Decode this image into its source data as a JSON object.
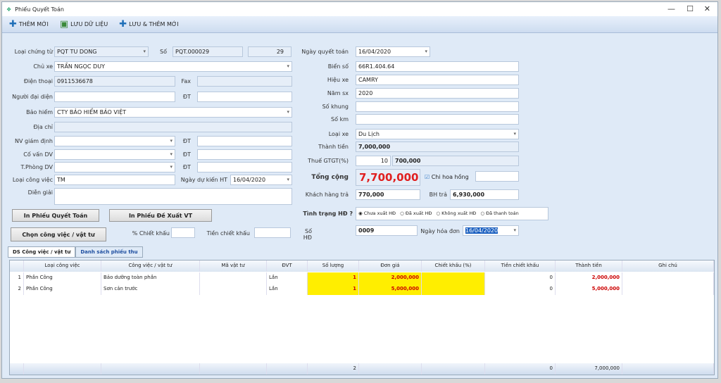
{
  "window": {
    "title": "Phiếu Quyết Toán",
    "min": "—",
    "max": "☐",
    "close": "✕"
  },
  "toolbar": {
    "new": "THÊM MỚI",
    "save": "LƯU DỮ LIỆU",
    "save_new": "LƯU & THÊM MỚI"
  },
  "left": {
    "loai_chung_tu_label": "Loại chứng từ",
    "loai_chung_tu": "PQT TU DONG",
    "so_label": "Số",
    "so": "PQT.000029",
    "so_num": "29",
    "chu_xe_label": "Chủ xe",
    "chu_xe": "TRẦN NGỌC DUY",
    "dien_thoai_label": "Điện thoại",
    "dien_thoai": "0911536678",
    "fax_label": "Fax",
    "nguoi_dai_dien_label": "Người đại diện",
    "dt_label": "ĐT",
    "bao_hiem_label": "Bảo hiểm",
    "bao_hiem": "CTY BẢO HIỂM BẢO VIỆT",
    "dia_chi_label": "Địa chỉ",
    "nv_giam_dinh_label": "NV giám định",
    "co_van_label": "Cố vấn DV",
    "t_phong_label": "T.Phòng DV",
    "loai_cong_viec_label": "Loại công việc",
    "loai_cong_viec": "TM",
    "ngay_du_kien_label": "Ngày dự kiến HT",
    "ngay_du_kien": "16/04/2020",
    "dien_giai_label": "Diễn giải",
    "btn_in_pqt": "In Phiếu Quyết Toán",
    "btn_in_dx": "In Phiếu Đề Xuất VT",
    "btn_chon": "Chọn công việc / vật tư",
    "chiet_khau_pct_label": "% Chiết khấu",
    "tien_chiet_khau_label": "Tiền chiết khấu"
  },
  "right": {
    "ngay_qt_label": "Ngày quyết toán",
    "ngay_qt": "16/04/2020",
    "bien_so_label": "Biển số",
    "bien_so": "66R1.404.64",
    "hieu_xe_label": "Hiệu xe",
    "hieu_xe": "CAMRY",
    "nam_sx_label": "Năm sx",
    "nam_sx": "2020",
    "so_khung_label": "Số khung",
    "so_km_label": "Số km",
    "loai_xe_label": "Loại xe",
    "loai_xe": "Du Lịch",
    "thanh_tien_label": "Thành tiền",
    "thanh_tien": "7,000,000",
    "thue_label": "Thuế GTGT(%)",
    "thue_pct": "10",
    "thue": "700,000",
    "tong_label": "Tổng cộng",
    "tong": "7,700,000",
    "chi_hoa_hong": "Chi hoa hồng",
    "kh_tra_label": "Khách hàng trả",
    "kh_tra": "770,000",
    "bh_tra_label": "BH trả",
    "bh_tra": "6,930,000",
    "tinh_trang_label": "Tình trạng HĐ ?",
    "status_options": [
      "Chưa xuất HĐ",
      "Đã xuất HĐ",
      "Không xuất HĐ",
      "Đã thanh toán"
    ],
    "so_hd_label": "Số HĐ",
    "so_hd": "0009",
    "ngay_hd_label": "Ngày hóa đơn",
    "ngay_hd": "16/04/2020"
  },
  "tabs": [
    "DS Công việc / vật tư",
    "Danh sách phiếu thu"
  ],
  "grid": {
    "headers": [
      "Loại công việc",
      "Công việc / vật tư",
      "Mã vật tư",
      "ĐVT",
      "Số lượng",
      "Đơn giá",
      "Chiết khấu (%)",
      "Tiền chiết khấu",
      "Thành tiền",
      "Ghi chú"
    ],
    "rows": [
      {
        "n": "1",
        "loai": "Phần Công",
        "cv": "Bảo dưỡng toàn phần",
        "ma": "",
        "dvt": "Lần",
        "sl": "1",
        "dg": "2,000,000",
        "ck": "",
        "tck": "0",
        "tt": "2,000,000",
        "gc": ""
      },
      {
        "n": "2",
        "loai": "Phần Công",
        "cv": "Sơn cản trước",
        "ma": "",
        "dvt": "Lần",
        "sl": "1",
        "dg": "5,000,000",
        "ck": "",
        "tck": "0",
        "tt": "5,000,000",
        "gc": ""
      }
    ],
    "footer": {
      "sl": "2",
      "tck": "0",
      "tt": "7,000,000"
    }
  }
}
